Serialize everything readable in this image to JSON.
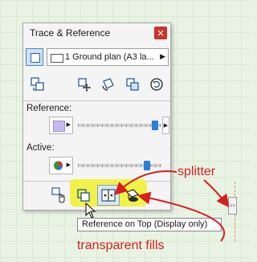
{
  "palette": {
    "title": "Trace & Reference",
    "close_label": "×",
    "view_select": "1 Ground plan (A3 la...",
    "reference_label": "Reference:",
    "active_label": "Active:",
    "reference_opacity": 0.92,
    "active_opacity": 0.83
  },
  "tooltip": {
    "text": "Reference on Top (Display only)"
  },
  "annotations": {
    "splitter": "splitter",
    "transparent_fills": "transparent fills"
  },
  "colors": {
    "highlight": "#f1f14a",
    "annotation": "#d61f1f",
    "accent": "#2a7fd6",
    "reference_swatch": "#c5b8f0"
  }
}
